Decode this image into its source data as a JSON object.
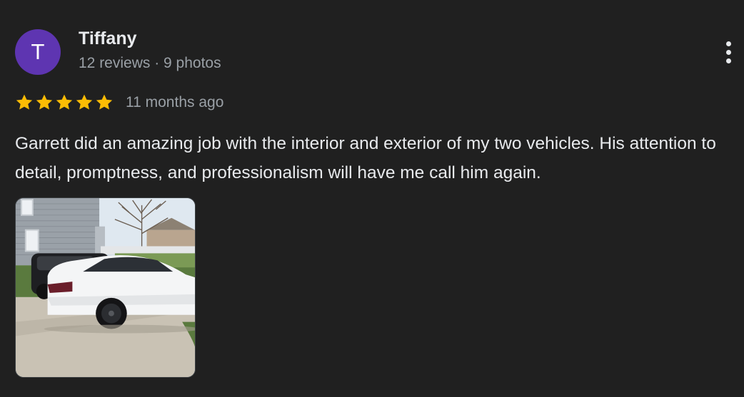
{
  "reviewer": {
    "initial": "T",
    "name": "Tiffany",
    "meta": "12 reviews · 9 photos",
    "avatar_color": "#5e35b1"
  },
  "review": {
    "rating": 5,
    "max_rating": 5,
    "date": "11 months ago",
    "text": "Garrett did an amazing job with the interior and exterior of my two vehicles. His attention to detail, promptness, and professionalism will have me call him again.",
    "star_color": "#fbbc04"
  },
  "menu": {
    "icon": "more-vert-icon"
  },
  "photos": [
    {
      "alt": "Review photo"
    }
  ]
}
